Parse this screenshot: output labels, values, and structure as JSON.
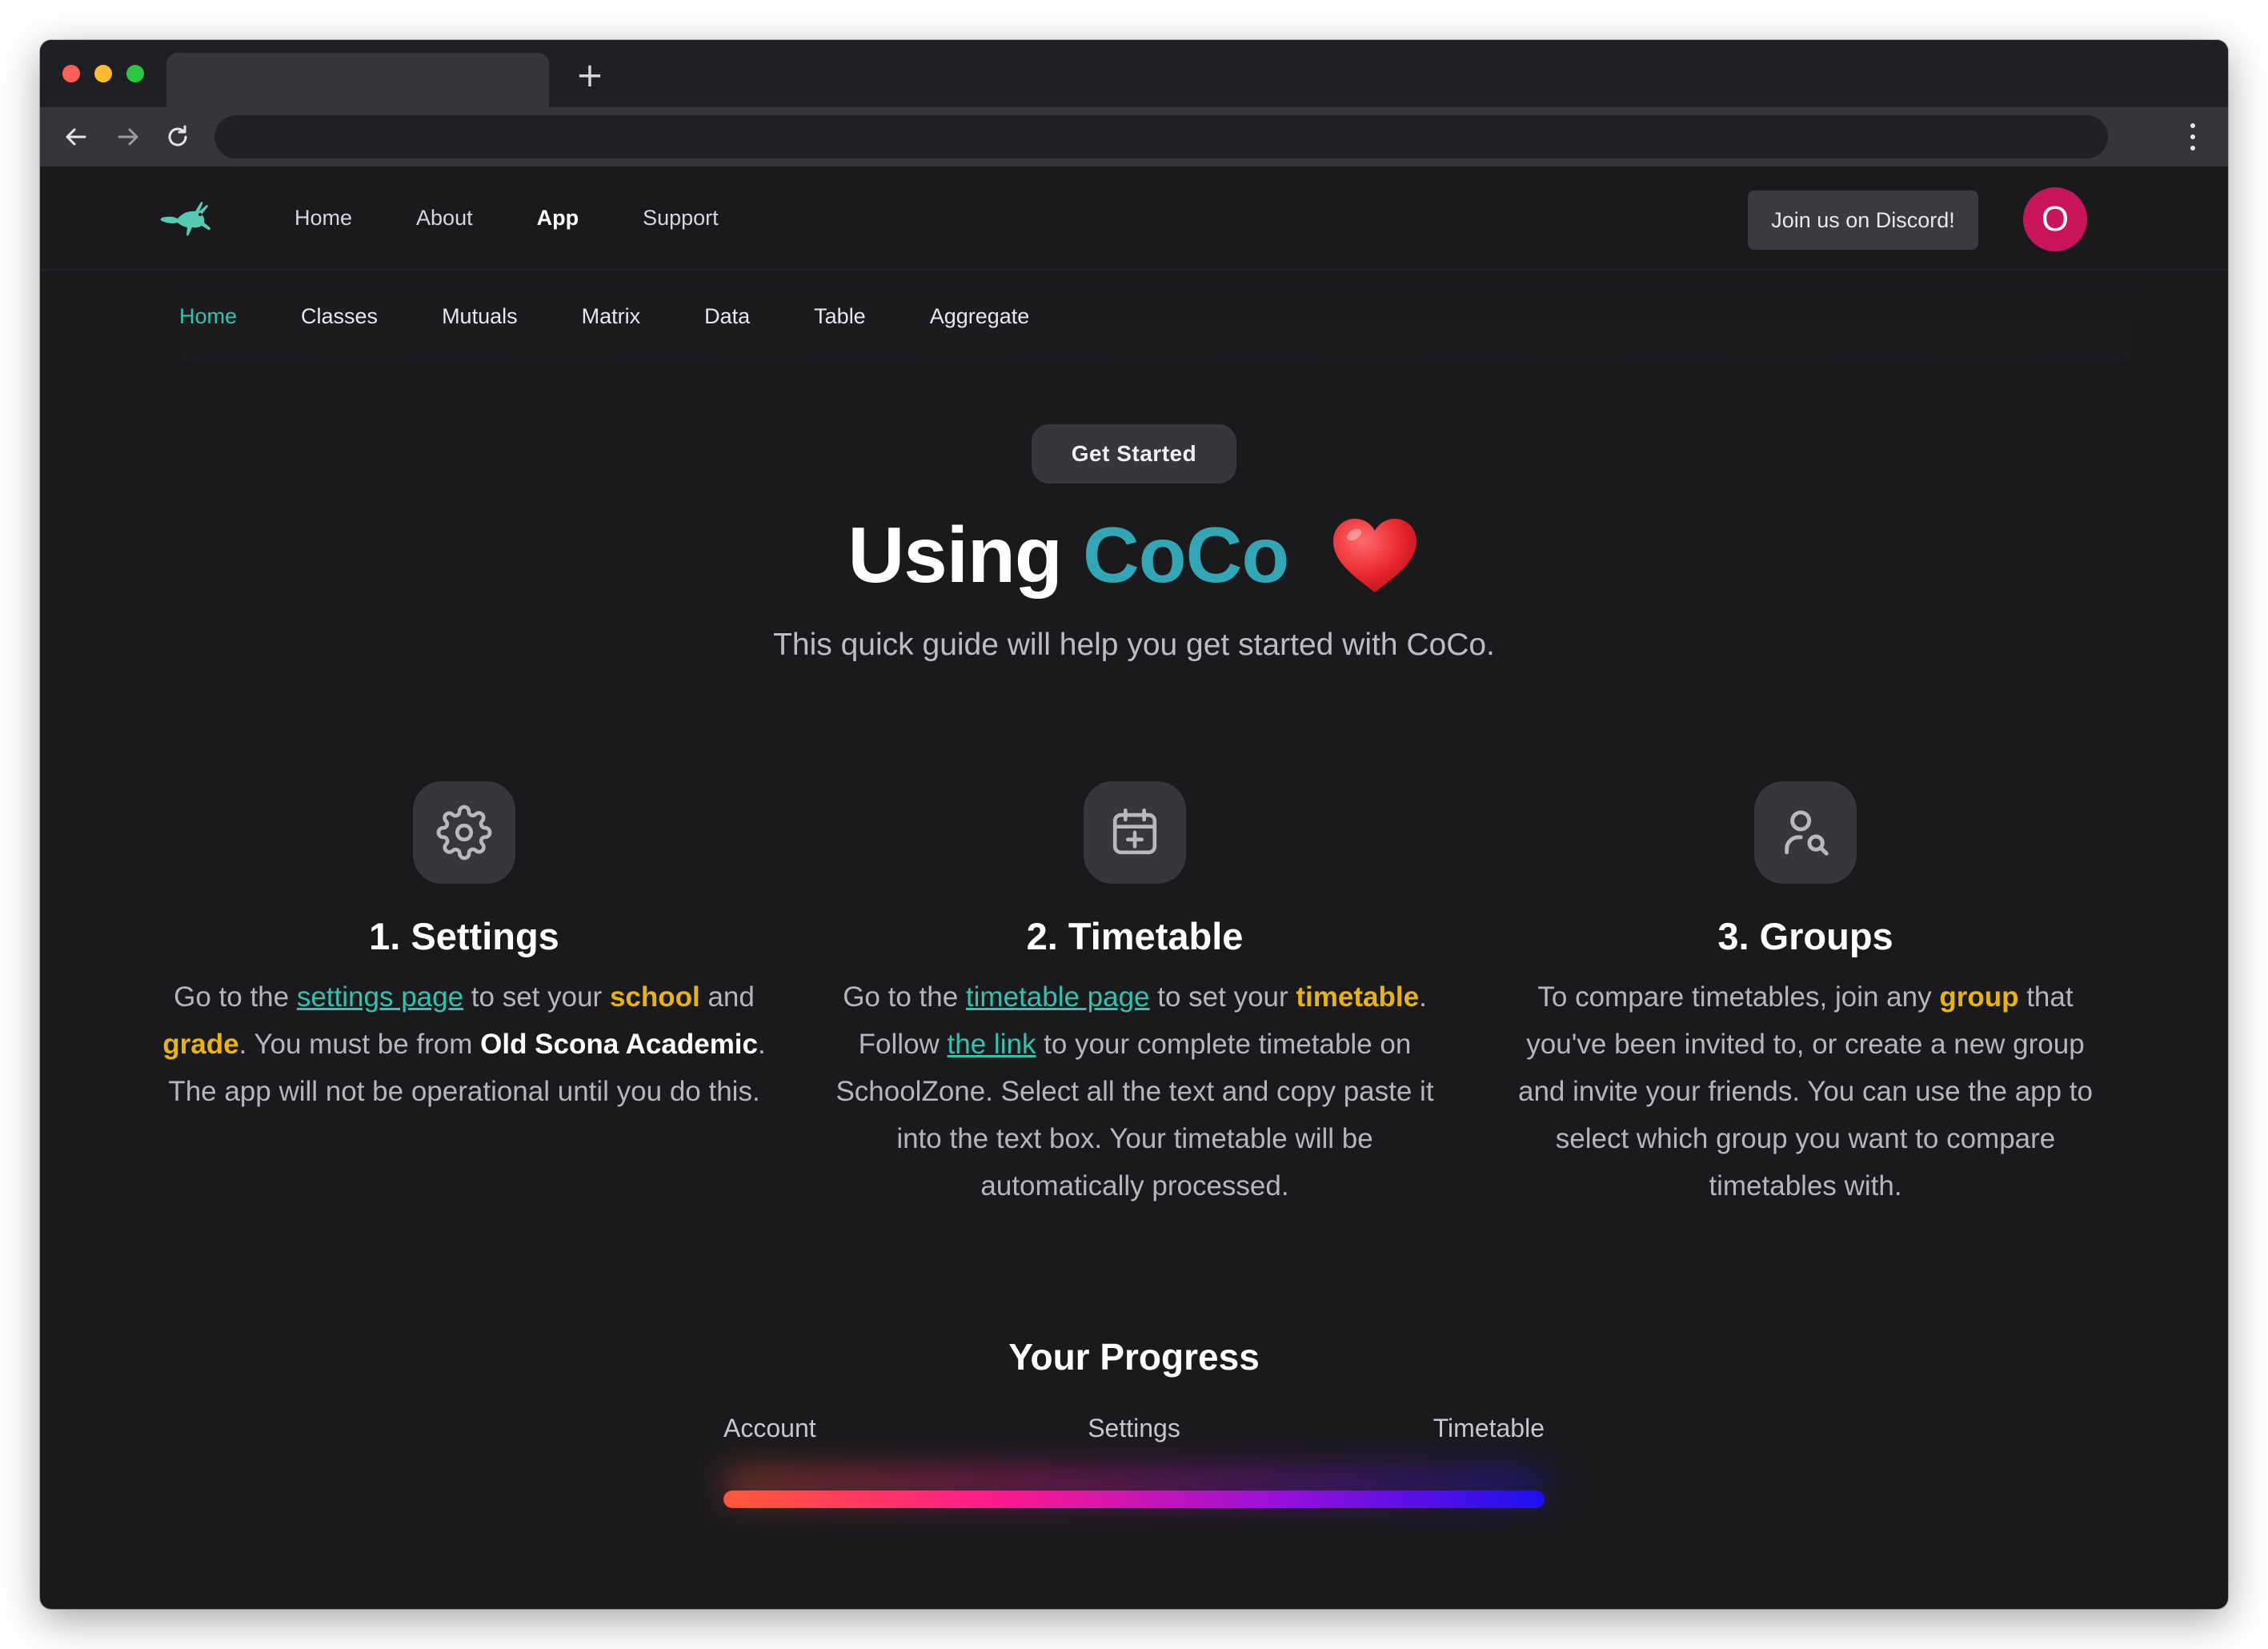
{
  "browser": {
    "new_tab_label": "+"
  },
  "header": {
    "nav": [
      "Home",
      "About",
      "App",
      "Support"
    ],
    "active_nav": "App",
    "discord_button": "Join us on Discord!",
    "avatar_initial": "O"
  },
  "subnav": {
    "items": [
      "Home",
      "Classes",
      "Mutuals",
      "Matrix",
      "Data",
      "Table",
      "Aggregate"
    ],
    "active": "Home"
  },
  "hero": {
    "pill": "Get Started",
    "title_prefix": "Using",
    "title_brand": "CoCo",
    "subtitle": "This quick guide will help you get started with CoCo."
  },
  "steps": [
    {
      "icon": "gear-icon",
      "title": "1. Settings",
      "t1": "Go to the ",
      "link": "settings page",
      "t2": " to set your ",
      "b1": "school",
      "t3": " and ",
      "b2": "grade",
      "t4": ". You must be from ",
      "b3": "Old Scona Academic",
      "t5": ". The app will not be operational until you do this."
    },
    {
      "icon": "calendar-add-icon",
      "title": "2. Timetable",
      "t1": "Go to the ",
      "link": "timetable page",
      "t2": " to set your ",
      "b1": "timetable",
      "t3": ". Follow ",
      "link2": "the link",
      "t4": " to your complete timetable on SchoolZone. Select all the text and copy paste it into the text box. Your timetable will be automatically processed."
    },
    {
      "icon": "user-search-icon",
      "title": "3. Groups",
      "t1": "To compare timetables, join any ",
      "b1": "group",
      "t2": " that you've been invited to, or create a new group and invite your friends. You can use the app to select which group you want to compare timetables with."
    }
  ],
  "progress": {
    "title": "Your Progress",
    "labels": [
      "Account",
      "Settings",
      "Timetable"
    ],
    "value_fraction": 1.0,
    "gradient_colors": [
      "#ff5a36",
      "#ff1a8c",
      "#9b10d8",
      "#1c10f0"
    ]
  },
  "colors": {
    "accent_teal": "#2ec4b0",
    "brand": "#31a6b4",
    "highlight": "#eab308",
    "avatar_bg": "#c8155c",
    "page_bg": "#1a1a1d"
  }
}
